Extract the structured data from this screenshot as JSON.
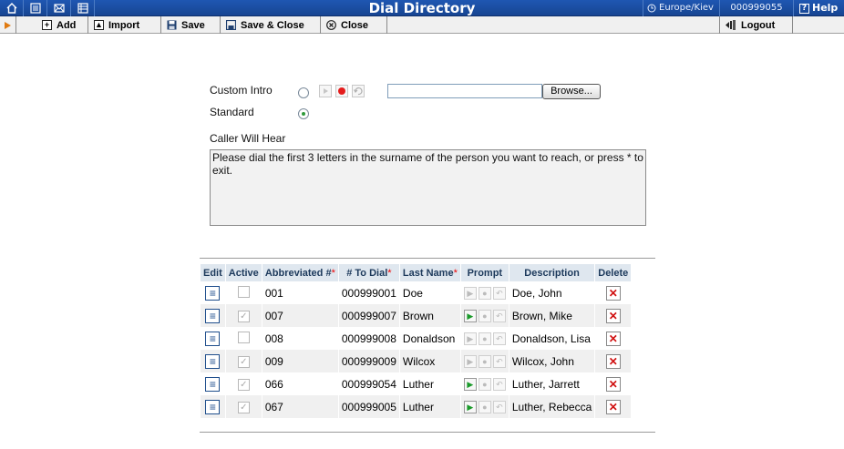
{
  "titlebar": {
    "title": "Dial Directory",
    "timezone": "Europe/Kiev",
    "account": "000999055",
    "help_label": "Help",
    "left_icons": [
      "home-icon",
      "list-icon",
      "mail-icon",
      "grid-icon"
    ],
    "color": "#1f57b2"
  },
  "toolbar": {
    "add_label": "Add",
    "import_label": "Import",
    "save_label": "Save",
    "save_close_label": "Save & Close",
    "close_label": "Close",
    "logout_label": "Logout"
  },
  "form": {
    "custom_intro_label": "Custom Intro",
    "standard_label": "Standard",
    "selected_option": "Standard",
    "file_value": "",
    "browse_label": "Browse...",
    "caller_will_hear_label": "Caller Will Hear",
    "caller_will_hear_text": "Please dial the first 3 letters in the surname of the person you want to reach, or press * to exit."
  },
  "table": {
    "headers": {
      "edit": "Edit",
      "active": "Active",
      "abbreviated": "Abbreviated #",
      "to_dial": "# To Dial",
      "last_name": "Last Name",
      "prompt": "Prompt",
      "description": "Description",
      "delete": "Delete"
    },
    "required_mark": "*",
    "rows": [
      {
        "active": false,
        "abbr": "001",
        "to_dial": "000999001",
        "last_name": "Doe",
        "has_prompt": false,
        "description": "Doe, John"
      },
      {
        "active": true,
        "abbr": "007",
        "to_dial": "000999007",
        "last_name": "Brown",
        "has_prompt": true,
        "description": "Brown, Mike"
      },
      {
        "active": false,
        "abbr": "008",
        "to_dial": "000999008",
        "last_name": "Donaldson",
        "has_prompt": false,
        "description": "Donaldson, Lisa"
      },
      {
        "active": true,
        "abbr": "009",
        "to_dial": "000999009",
        "last_name": "Wilcox",
        "has_prompt": false,
        "description": "Wilcox, John"
      },
      {
        "active": true,
        "abbr": "066",
        "to_dial": "000999054",
        "last_name": "Luther",
        "has_prompt": true,
        "description": "Luther, Jarrett"
      },
      {
        "active": true,
        "abbr": "067",
        "to_dial": "000999005",
        "last_name": "Luther",
        "has_prompt": true,
        "description": "Luther, Rebecca"
      }
    ]
  }
}
